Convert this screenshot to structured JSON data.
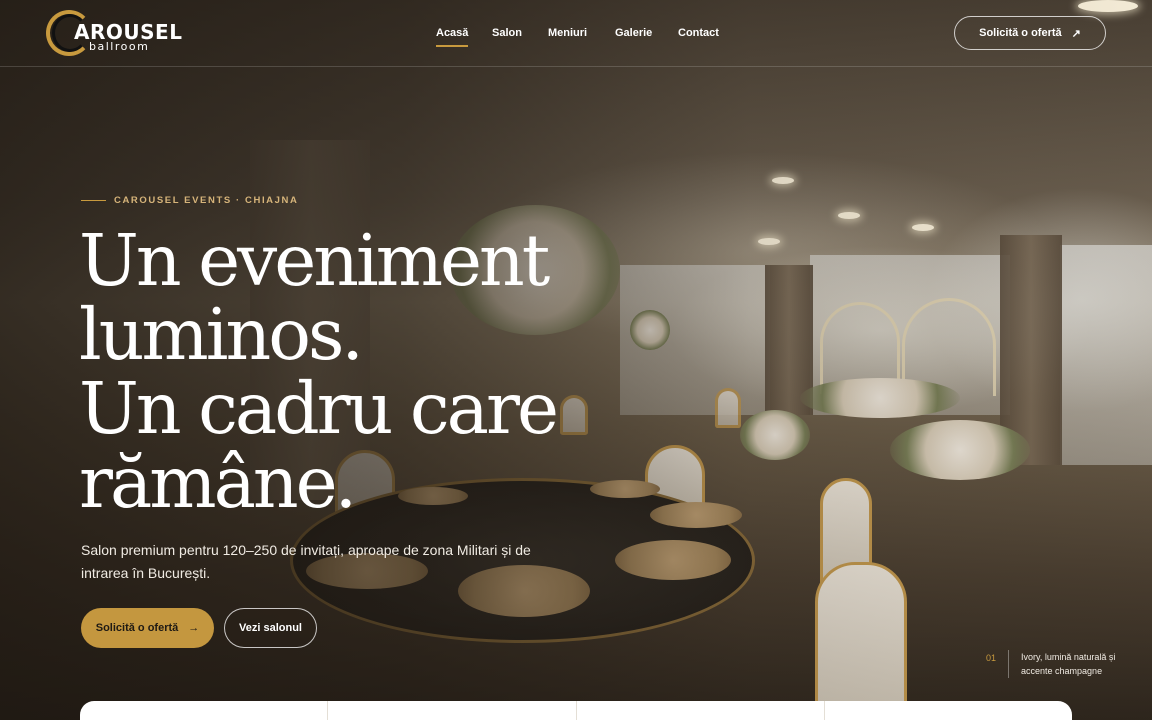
{
  "brand": {
    "name": "AROUSEL",
    "sub": "ballroom"
  },
  "nav": {
    "links": [
      {
        "label": "Acasă",
        "active": true
      },
      {
        "label": "Salon",
        "active": false
      },
      {
        "label": "Meniuri",
        "active": false
      },
      {
        "label": "Galerie",
        "active": false
      },
      {
        "label": "Contact",
        "active": false
      }
    ],
    "cta_label": "Solicită o ofertă",
    "cta_icon": "arrow-up-right-icon"
  },
  "hero": {
    "eyebrow": "CAROUSEL EVENTS · CHIAJNA",
    "headline": [
      "Un eveniment",
      "luminos.",
      "Un cadru care",
      "rămâne."
    ],
    "subtext": "Salon premium pentru 120–250 de invitați, aproape de zona Militari și de intrarea în București.",
    "primary_cta": "Solicită o ofertă",
    "primary_cta_icon": "arrow-right-icon",
    "secondary_cta": "Vezi salonul"
  },
  "caption": {
    "index": "01",
    "text": "Ivory, lumină naturală și accente champagne"
  },
  "colors": {
    "accent": "#c4973f",
    "eyebrow": "#d6b47a"
  }
}
